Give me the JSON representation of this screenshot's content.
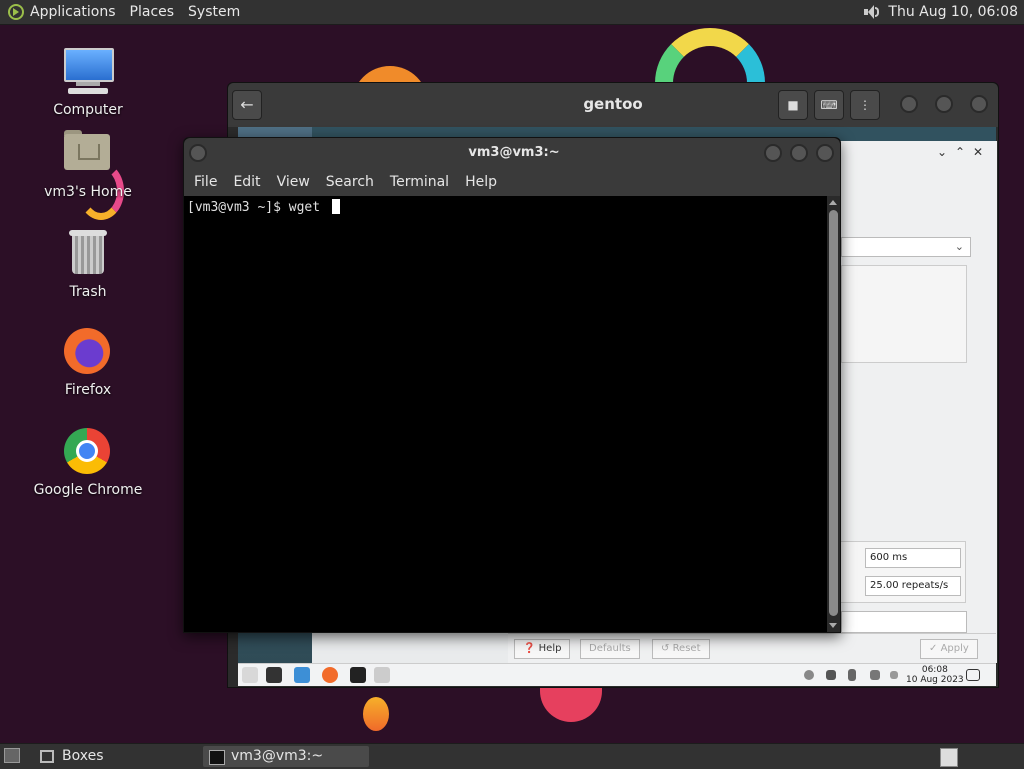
{
  "top_panel": {
    "menus": [
      "Applications",
      "Places",
      "System"
    ],
    "clock": "Thu Aug 10, 06:08"
  },
  "desktop_icons": [
    {
      "label": "Computer"
    },
    {
      "label": "vm3's Home"
    },
    {
      "label": "Trash"
    },
    {
      "label": "Firefox"
    },
    {
      "label": "Google Chrome"
    }
  ],
  "boxes_window": {
    "title": "gentoo",
    "guest": {
      "delay_value": "600 ms",
      "rate_value": "25.00 repeats/s",
      "buttons": {
        "help": "Help",
        "defaults": "Defaults",
        "reset": "Reset",
        "apply": "Apply"
      },
      "clock_time": "06:08",
      "clock_date": "10 Aug 2023"
    }
  },
  "terminal": {
    "title": "vm3@vm3:~",
    "menu": [
      "File",
      "Edit",
      "View",
      "Search",
      "Terminal",
      "Help"
    ],
    "prompt": "[vm3@vm3 ~]$ wget "
  },
  "bottom_panel": {
    "tasks": [
      {
        "label": "Boxes"
      },
      {
        "label": "vm3@vm3:~"
      }
    ]
  },
  "colors": {
    "desktop_bg": "#2c0f26",
    "panel": "#323232",
    "terminal_bg": "#000000"
  }
}
